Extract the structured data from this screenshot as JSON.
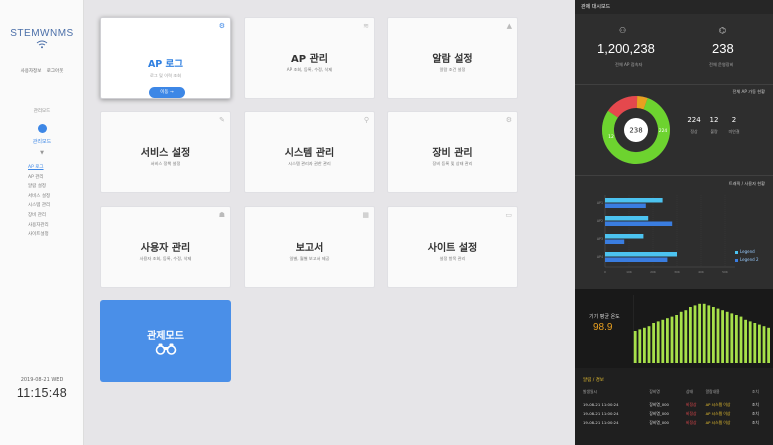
{
  "sidebar": {
    "brand": "STEMWNMS",
    "links": [
      "사용자정보",
      "로그아웃"
    ],
    "mode_label": "관리모드",
    "mode_name": "관리모드",
    "caret": "▼",
    "menu": [
      "AP 로그",
      "AP 관리",
      "알람 설정",
      "서비스 설정",
      "시스템 관리",
      "장비 관리",
      "사용자관리",
      "사이트설정"
    ],
    "date": "2019-08-21 WED",
    "time": "11:15:48"
  },
  "cards": [
    {
      "title": "AP 로그",
      "sub": "로그 및 이력 조회",
      "button": "이동 →",
      "icon": "⚙"
    },
    {
      "title": "AP 관리",
      "sub": "AP 조회, 등록, 수정, 삭제",
      "icon": "≋"
    },
    {
      "title": "알람 설정",
      "sub": "알람 조건 설정",
      "icon": "▲"
    },
    {
      "title": "서비스 설정",
      "sub": "서비스 정책 설정",
      "icon": "✎"
    },
    {
      "title": "시스템 관리",
      "sub": "시스템 관리자 권한 관리",
      "icon": "⚲"
    },
    {
      "title": "장비 관리",
      "sub": "장비 등록 및 상태 관리",
      "icon": "⚙"
    },
    {
      "title": "사용자 관리",
      "sub": "사용자 조회, 등록, 수정, 삭제",
      "icon": "☗"
    },
    {
      "title": "보고서",
      "sub": "일별, 월별 보고서 제공",
      "icon": "▦"
    },
    {
      "title": "사이트 설정",
      "sub": "설정 항목 관리",
      "icon": "▭"
    },
    {
      "title": "관제모드",
      "icon": "binoculars-icon"
    }
  ],
  "dash": {
    "header": "관제 대시보드",
    "stat1": {
      "value": "1,200,238",
      "label": "전체 AP 접속자"
    },
    "stat2": {
      "value": "238",
      "label": "전체 운영장비"
    },
    "ap_title": "전체 AP 가동 현황",
    "donut_center": "238",
    "donut_labels": [
      "224",
      "12"
    ],
    "ap_stats": [
      {
        "num": "224",
        "label": "정상"
      },
      {
        "num": "12",
        "label": "불량"
      },
      {
        "num": "2",
        "label": "미연결"
      }
    ],
    "traffic_title": "트래픽 / 사용자 현황",
    "bar_categories": [
      "AP1",
      "AP2",
      "AP3",
      "AP4"
    ],
    "bar_x_ticks": [
      "0",
      "10K",
      "20K",
      "30K",
      "40K",
      "50K"
    ],
    "legend": [
      "Legend",
      "Legend 2"
    ],
    "temp_label": "기기 평균 온도",
    "temp_value": "98.9",
    "alert_title": "알림 / 경보",
    "alert_headers": [
      "발생일시",
      "장비명",
      "상태",
      "알람내용",
      "조치"
    ],
    "alerts": [
      [
        "19-08-21 11:00:24",
        "장비명_000",
        "비정상",
        "AP 시스템 이상",
        "조치"
      ],
      [
        "19-08-21 11:00:24",
        "장비명_000",
        "비정상",
        "AP 시스템 이상",
        "조치"
      ],
      [
        "19-08-21 11:00:24",
        "장비명_000",
        "비정상",
        "AP 시스템 이상",
        "조치"
      ]
    ]
  },
  "colors": {
    "accent": "#3d87e6",
    "dash_bg": "#2e2e2e",
    "green": "#6dd32f",
    "red": "#e5484d"
  },
  "chart_data": [
    {
      "type": "pie",
      "title": "전체 AP 가동 현황",
      "categories": [
        "정상",
        "불량",
        "미연결"
      ],
      "values": [
        224,
        12,
        2
      ]
    },
    {
      "type": "bar",
      "title": "트래픽 / 사용자 현황",
      "categories": [
        "AP1",
        "AP2",
        "AP3",
        "AP4"
      ],
      "series": [
        {
          "name": "Legend",
          "values": [
            24,
            18,
            16,
            30
          ]
        },
        {
          "name": "Legend 2",
          "values": [
            17,
            28,
            8,
            26
          ]
        }
      ],
      "xlim": [
        0,
        50
      ]
    },
    {
      "type": "bar",
      "title": "기기 평균 온도",
      "series": [
        {
          "name": "",
          "values": [
            40,
            42,
            44,
            46,
            50,
            52,
            54,
            56,
            58,
            60,
            64,
            66,
            70,
            72,
            74,
            74,
            72,
            70,
            68,
            66,
            64,
            62,
            60,
            58,
            54,
            52,
            50,
            48,
            46,
            44
          ]
        }
      ]
    }
  ]
}
